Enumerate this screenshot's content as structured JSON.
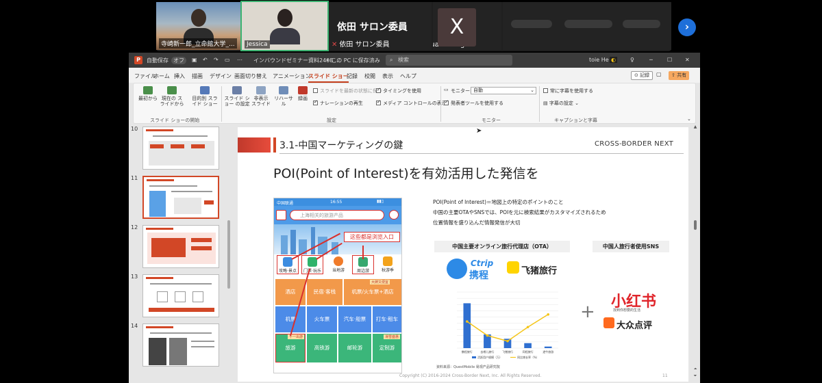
{
  "zoom": {
    "participants": [
      {
        "name": "寺崎新一郎_立命館大学_..."
      },
      {
        "name": "Jessica"
      },
      {
        "name": "依田 サロン委員",
        "display": "依田 サロン委員"
      },
      {
        "name": "Xuan Wang",
        "initial": "X"
      }
    ],
    "next_icon": "chevron-right-icon"
  },
  "ppt": {
    "title_items": [
      "自動保存",
      "オフ",
      "インバウンドゼミナー資料2408 ...",
      "• この PC に保存済み"
    ],
    "search_placeholder": "検索",
    "user": "toie He",
    "tabs": [
      "ファイル",
      "ホーム",
      "挿入",
      "描画",
      "デザイン",
      "画面切り替え",
      "アニメーション",
      "スライド ショー",
      "記録",
      "校閲",
      "表示",
      "ヘルプ"
    ],
    "active_tab": "スライド ショー",
    "record_label": "記録",
    "share_label": "共有",
    "ribbon": {
      "from_beginning": "最初から",
      "from_current": "現在の スライドから",
      "custom_show": "目的別 スライド ショー",
      "setup_show": "スライド ショー の設定",
      "hide_slide": "非表示 スライド",
      "rehearse": "リハーサル",
      "record": "録画",
      "group_start": "スライド ショーの開始",
      "group_setup": "設定",
      "chk_save_state": "スライドを最新の状態に保つ",
      "chk_narration": "ナレーションの再生",
      "chk_timing": "タイミングを使用",
      "chk_media": "メディア コントロールの表示",
      "monitor_label": "モニター:",
      "monitor_value": "自動",
      "presenter_view": "発表者ツールを使用する",
      "group_monitor": "モニター",
      "always_subtitles": "常に字幕を使用する",
      "subtitle_settings": "字幕の設定",
      "group_captions": "キャプションと字幕"
    },
    "thumbnails": [
      {
        "num": "10"
      },
      {
        "num": "11"
      },
      {
        "num": "12"
      },
      {
        "num": "13"
      },
      {
        "num": "14"
      }
    ]
  },
  "slide": {
    "title": "3.1-中国マーケティングの鍵",
    "brand": "CROSS-BORDER NEXT",
    "heading": "POI(Point of Interest)を有効活用した発信を",
    "desc": [
      "POI(Point of Interest)＝地図上の特定のポイントのこと",
      "中国の主要OTAやSNSでは、POIを元に検索結果がカスタマイズされるため",
      "位置情報を盛り込んだ情報発信が大切"
    ],
    "ota_label": "中国主要オンライン旅行代理店（OTA）",
    "sns_label": "中国人旅行者使用SNS",
    "plus": "+",
    "logos": {
      "ctrip_en": "Ctrip",
      "ctrip_cn": "携程",
      "fliggy": "飞猪旅行",
      "xhs": "小红书",
      "xhs_sub": "找到你想要的生活",
      "dianping": "大众点评"
    },
    "phone": {
      "status_left": "中国联通",
      "status_time": "16:55",
      "search_text": "上海相关的旅游产品",
      "callout": "这些都是浏览入口",
      "cats": [
        "攻略·景点",
        "门票·玩乐",
        "当地游",
        "周边游",
        "秋游季"
      ],
      "grid": [
        [
          "酒店",
          "民宿·客栈",
          "机票/火车票+酒店"
        ],
        [
          "机票",
          "火车票",
          "汽车·船票",
          "打车·租车"
        ],
        [
          "旅游",
          "高铁游",
          "邮轮游",
          "定制游"
        ]
      ],
      "badge_1": "大牌又便宜",
      "badge_2": "十一出游",
      "badge_3": "滑雪盛惠"
    },
    "footnote": "資料来源：QuestMobile 易观产品研究院",
    "copyright": "Copyright (C) 2016-2024 Cross-Border Next, Inc. All Rights Reserved.",
    "page_number": "11"
  },
  "chart_data": {
    "type": "bar",
    "categories": [
      "携程旅行",
      "去哪儿旅行",
      "飞猪旅行",
      "同程旅行",
      "途牛旅游"
    ],
    "series": [
      {
        "name": "活跃用户规模（万）",
        "values": [
          7200,
          2200,
          1500,
          800,
          250
        ],
        "kind": "bar",
        "color": "#2f6fd0"
      },
      {
        "name": "同比增长率（%）",
        "values": [
          38,
          18,
          10,
          30,
          48
        ],
        "kind": "line",
        "color": "#f5c518"
      }
    ],
    "ylim": [
      0,
      9000
    ],
    "y2lim": [
      0,
      80
    ],
    "grid": true,
    "legend": "bottom"
  }
}
